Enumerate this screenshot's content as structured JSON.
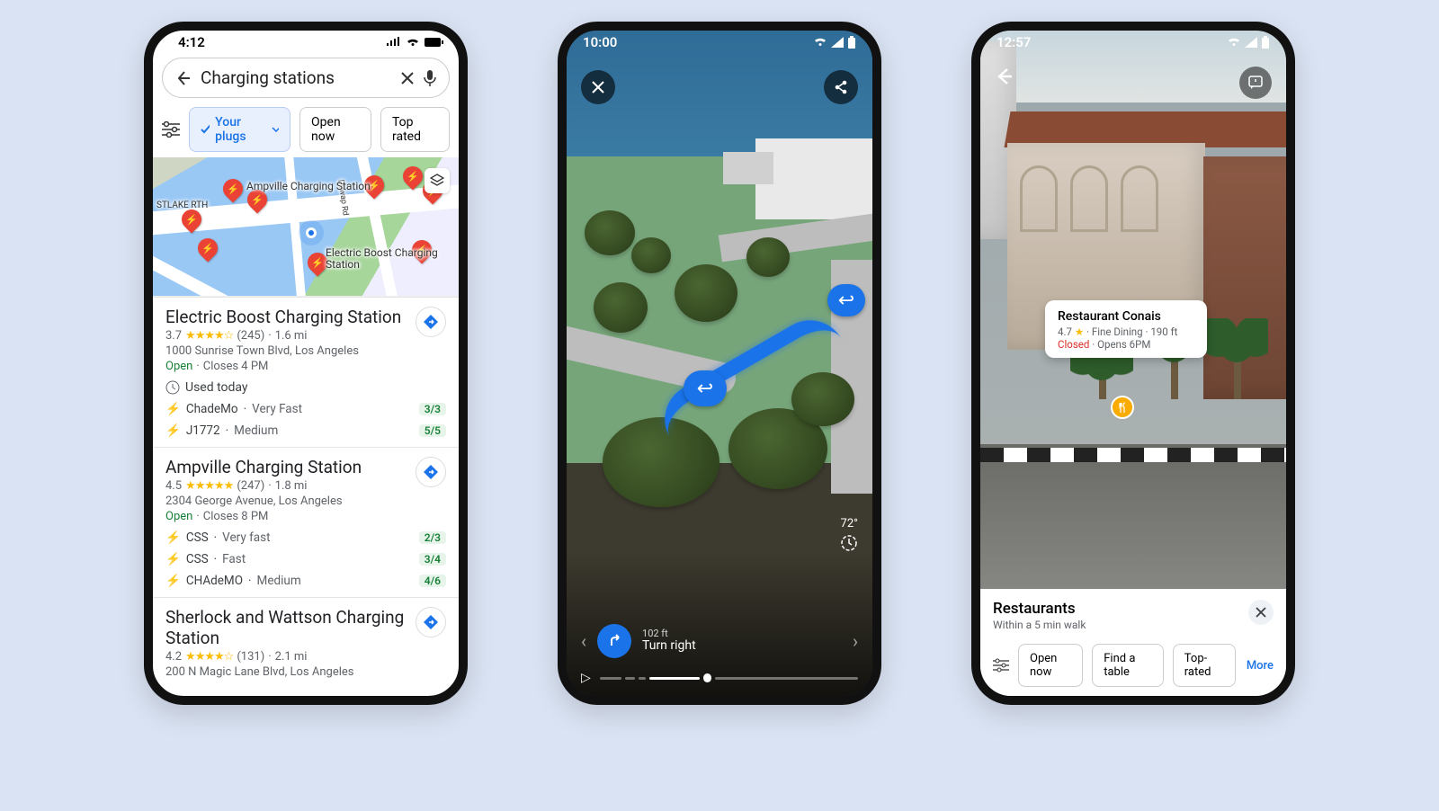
{
  "phone1": {
    "status_time": "4:12",
    "search_query": "Charging stations",
    "chips": {
      "your_plugs": "Your plugs",
      "open_now": "Open now",
      "top_rated": "Top rated"
    },
    "map_labels": {
      "ampville": "Ampville Charging\nStation",
      "eboost": "Electric Boost\nCharging Station",
      "lake": "STLAKE\nRTH",
      "dewap": "Dewap Rd"
    },
    "results": [
      {
        "name": "Electric Boost Charging Station",
        "rating": "3.7",
        "reviews": "(245)",
        "distance": "1.6 mi",
        "address": "1000 Sunrise Town Blvd, Los Angeles",
        "open_label": "Open",
        "hours": "Closes 4 PM",
        "used_today": "Used today",
        "plugs": [
          {
            "name": "ChadeMo",
            "speed": "Very Fast",
            "avail": "3/3"
          },
          {
            "name": "J1772",
            "speed": "Medium",
            "avail": "5/5"
          }
        ]
      },
      {
        "name": "Ampville Charging Station",
        "rating": "4.5",
        "reviews": "(247)",
        "distance": "1.8 mi",
        "address": "2304 George Avenue, Los Angeles",
        "open_label": "Open",
        "hours": "Closes 8 PM",
        "plugs": [
          {
            "name": "CSS",
            "speed": "Very fast",
            "avail": "2/3"
          },
          {
            "name": "CSS",
            "speed": "Fast",
            "avail": "3/4"
          },
          {
            "name": "CHAdeMO",
            "speed": "Medium",
            "avail": "4/6"
          }
        ]
      },
      {
        "name": "Sherlock and Wattson Charging Station",
        "rating": "4.2",
        "reviews": "(131)",
        "distance": "2.1 mi",
        "address": "200 N Magic Lane Blvd, Los Angeles"
      }
    ]
  },
  "phone2": {
    "status_time": "10:00",
    "temperature": "72°",
    "direction_distance": "102 ft",
    "direction_text": "Turn right"
  },
  "phone3": {
    "status_time": "12:57",
    "place": {
      "name": "Restaurant Conais",
      "rating": "4.7",
      "category": "Fine Dining",
      "distance": "190 ft",
      "status": "Closed",
      "opens": "Opens 6PM"
    },
    "sheet": {
      "title": "Restaurants",
      "subtitle": "Within a 5 min walk",
      "chips": {
        "open_now": "Open now",
        "find_table": "Find a table",
        "top_rated": "Top-rated",
        "more": "More"
      }
    }
  }
}
